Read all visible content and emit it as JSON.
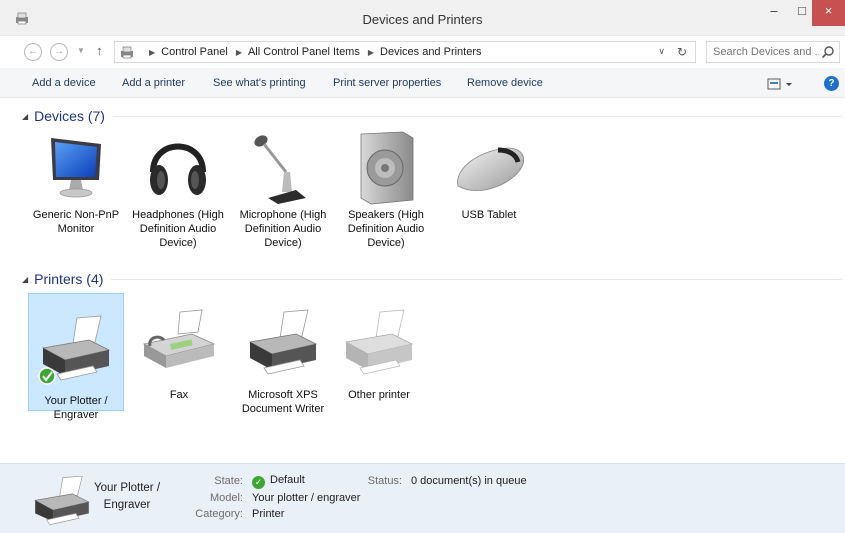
{
  "window": {
    "title": "Devices and Printers",
    "minimize": "–",
    "maximize": "□",
    "close": "×"
  },
  "address": {
    "crumbs": [
      "Control Panel",
      "All Control Panel Items",
      "Devices and Printers"
    ],
    "search_placeholder": "Search Devices and ..."
  },
  "commands": [
    "Add a device",
    "Add a printer",
    "See what's printing",
    "Print server properties",
    "Remove device"
  ],
  "groups": {
    "devices": {
      "label": "Devices (7)",
      "items": [
        {
          "name": "Generic Non-PnP Monitor",
          "icon": "monitor-icon"
        },
        {
          "name": "Headphones (High Definition Audio Device)",
          "icon": "headphones-icon"
        },
        {
          "name": "Microphone (High Definition Audio Device)",
          "icon": "microphone-icon"
        },
        {
          "name": "Speakers (High Definition Audio Device)",
          "icon": "speakers-icon"
        },
        {
          "name": "USB Tablet",
          "icon": "mouse-icon"
        }
      ]
    },
    "printers": {
      "label": "Printers (4)",
      "items": [
        {
          "name": "Your Plotter / Engraver",
          "icon": "printer-icon",
          "selected": true,
          "default": true
        },
        {
          "name": "Fax",
          "icon": "fax-icon"
        },
        {
          "name": "Microsoft XPS Document Writer",
          "icon": "printer-icon"
        },
        {
          "name": "Other printer",
          "icon": "printer-icon"
        }
      ]
    }
  },
  "details": {
    "name": "Your Plotter / Engraver",
    "state_label": "State:",
    "state_value": "Default",
    "model_label": "Model:",
    "model_value": "Your plotter / engraver",
    "category_label": "Category:",
    "category_value": "Printer",
    "status_label": "Status:",
    "status_value": "0 document(s) in queue"
  },
  "colors": {
    "selection": "#cce8ff",
    "close_button": "#c75050",
    "group_header": "#1e3287",
    "details_pane": "#eaf0f8"
  }
}
